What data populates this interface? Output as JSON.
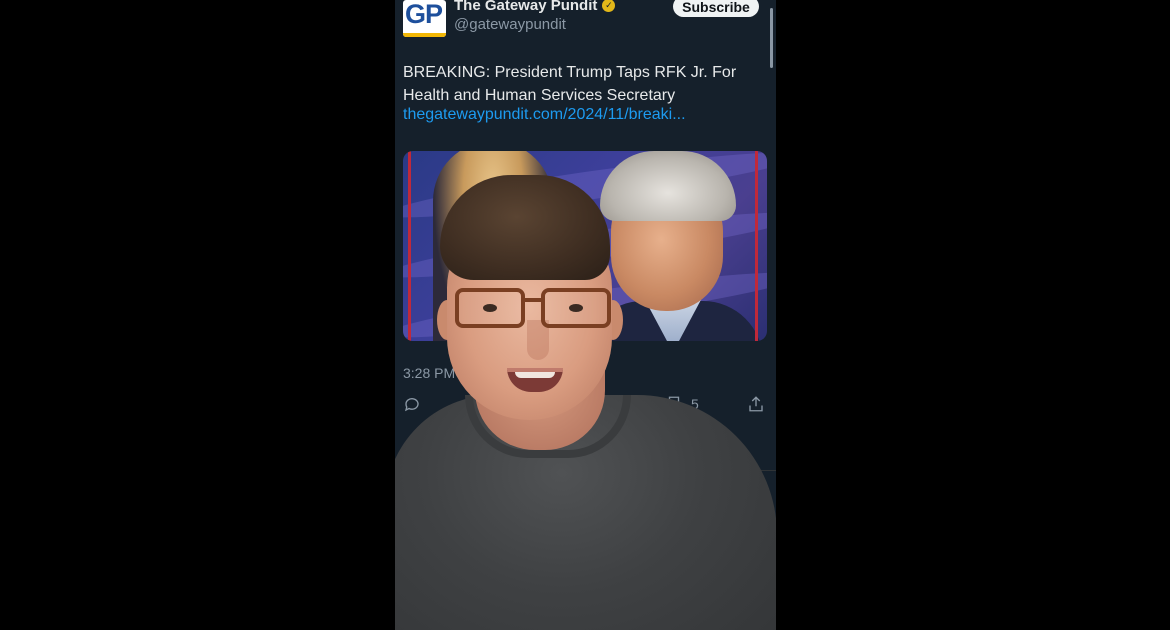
{
  "tweet": {
    "account_name": "The Gateway Pundit",
    "handle": "@gatewaypundit",
    "avatar_text": "GP",
    "subscribe_label": "Subscribe",
    "text": "BREAKING: President Trump Taps RFK Jr. For Health and Human Services Secretary",
    "link": "thegatewaypundit.com/2024/11/breaki...",
    "timestamp": "3:28 PM · 1",
    "bookmark_count": "5",
    "more_label": "···"
  },
  "colors": {
    "background": "#15202b",
    "link": "#1d9bf0",
    "verified_badge": "#e2b719",
    "muted_text": "#8b98a5"
  },
  "icons": {
    "verified": "verified-badge-icon",
    "reply": "reply-icon",
    "bookmark": "bookmark-icon",
    "share": "share-icon",
    "notifications": "bell-icon",
    "messages": "mail-icon"
  }
}
